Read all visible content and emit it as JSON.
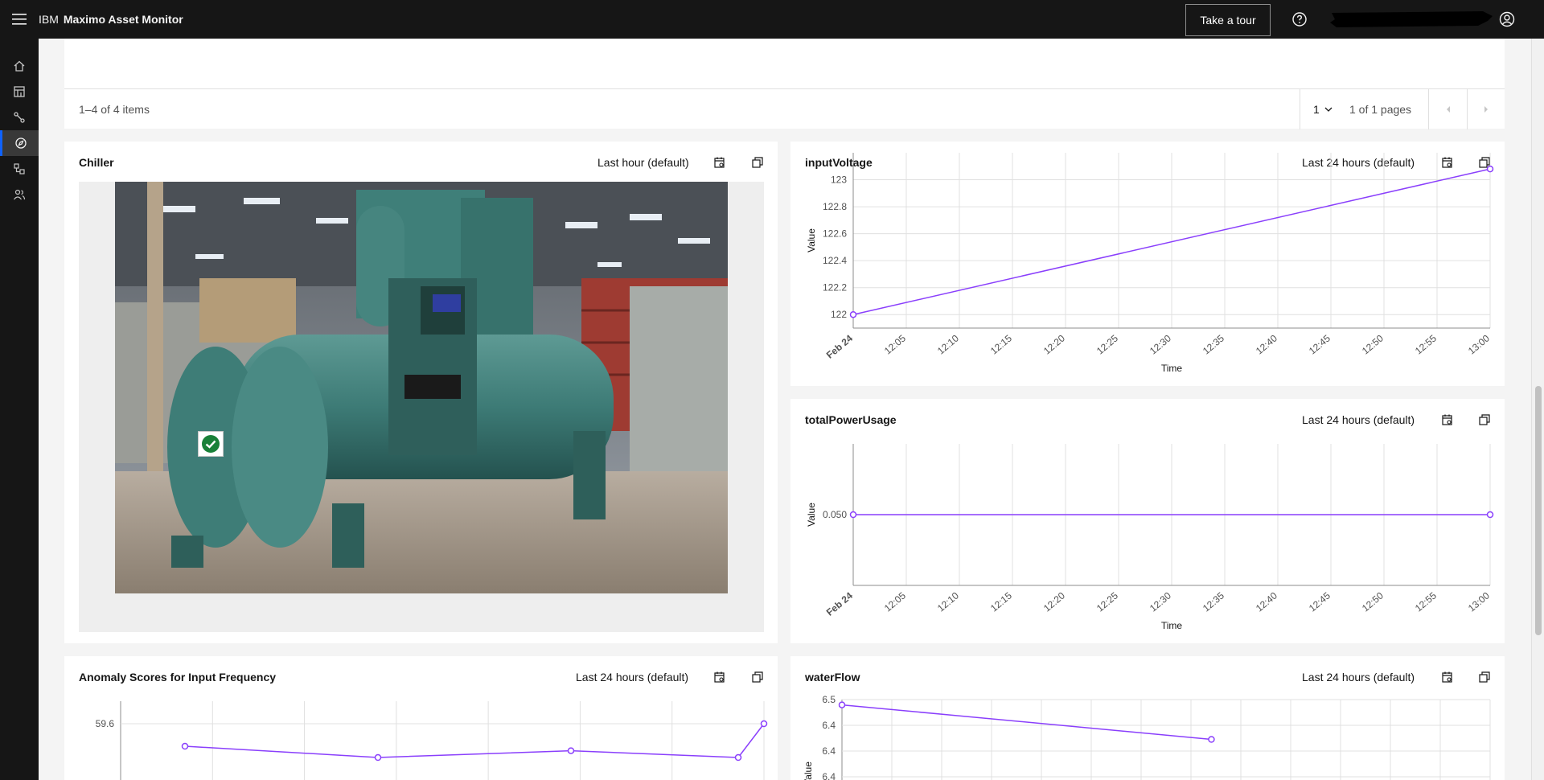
{
  "header": {
    "brand_prefix": "IBM",
    "brand_name": "Maximo Asset Monitor",
    "tour_label": "Take a tour"
  },
  "sidenav": {
    "items": [
      "home-icon",
      "dashboard-icon",
      "graph-icon",
      "monitor-icon",
      "hierarchy-icon",
      "users-icon"
    ],
    "active_index": 3,
    "accent": "#0f62fe"
  },
  "table": {
    "items_label": "1–4 of 4 items",
    "page_value": "1",
    "page_of": "1 of 1 pages"
  },
  "cards": {
    "chiller": {
      "title": "Chiller",
      "range": "Last hour (default)"
    },
    "input_voltage": {
      "title": "inputVoltage",
      "range": "Last 24 hours (default)"
    },
    "total_power": {
      "title": "totalPowerUsage",
      "range": "Last 24 hours (default)"
    },
    "anomaly": {
      "title": "Anomaly Scores for Input Frequency",
      "range": "Last 24 hours (default)"
    },
    "water_flow": {
      "title": "waterFlow",
      "range": "Last 24 hours (default)"
    }
  },
  "chart_data": [
    {
      "id": "inputVoltage",
      "type": "line",
      "xlabel": "Time",
      "ylabel": "Value",
      "x_ticks": [
        "Feb 24",
        "12:05",
        "12:10",
        "12:15",
        "12:20",
        "12:25",
        "12:30",
        "12:35",
        "12:40",
        "12:45",
        "12:50",
        "12:55",
        "13:00"
      ],
      "y_ticks": [
        "122",
        "122.2",
        "122.4",
        "122.6",
        "122.8",
        "123"
      ],
      "ylim": [
        121.9,
        123.2
      ],
      "series": [
        {
          "x": [
            "12:00",
            "13:00"
          ],
          "values": [
            122.0,
            123.08
          ]
        }
      ],
      "color": "#8a3ffc"
    },
    {
      "id": "totalPowerUsage",
      "type": "line",
      "xlabel": "Time",
      "ylabel": "Value",
      "x_ticks": [
        "Feb 24",
        "12:05",
        "12:10",
        "12:15",
        "12:20",
        "12:25",
        "12:30",
        "12:35",
        "12:40",
        "12:45",
        "12:50",
        "12:55",
        "13:00"
      ],
      "y_ticks": [
        "0.050"
      ],
      "ylim": [
        0.045,
        0.055
      ],
      "series": [
        {
          "x": [
            "12:00",
            "13:00"
          ],
          "values": [
            0.05,
            0.05
          ]
        }
      ],
      "color": "#8a3ffc"
    },
    {
      "id": "anomalyScores",
      "type": "line",
      "y_ticks": [
        "59.6"
      ],
      "ylim": [
        59.4,
        59.7
      ],
      "series": [
        {
          "points": [
            [
              0.1,
              59.5
            ],
            [
              0.4,
              59.45
            ],
            [
              0.7,
              59.48
            ],
            [
              0.96,
              59.45
            ],
            [
              1.0,
              59.6
            ]
          ]
        }
      ],
      "color": "#8a3ffc"
    },
    {
      "id": "waterFlow",
      "type": "line",
      "ylabel": "Value",
      "y_ticks": [
        "6.5",
        "6.4",
        "6.4",
        "6.4"
      ],
      "ylim": [
        6.3,
        6.5
      ],
      "series": [
        {
          "points": [
            [
              0.0,
              6.48
            ],
            [
              0.57,
              6.35
            ]
          ]
        }
      ],
      "color": "#8a3ffc"
    }
  ]
}
